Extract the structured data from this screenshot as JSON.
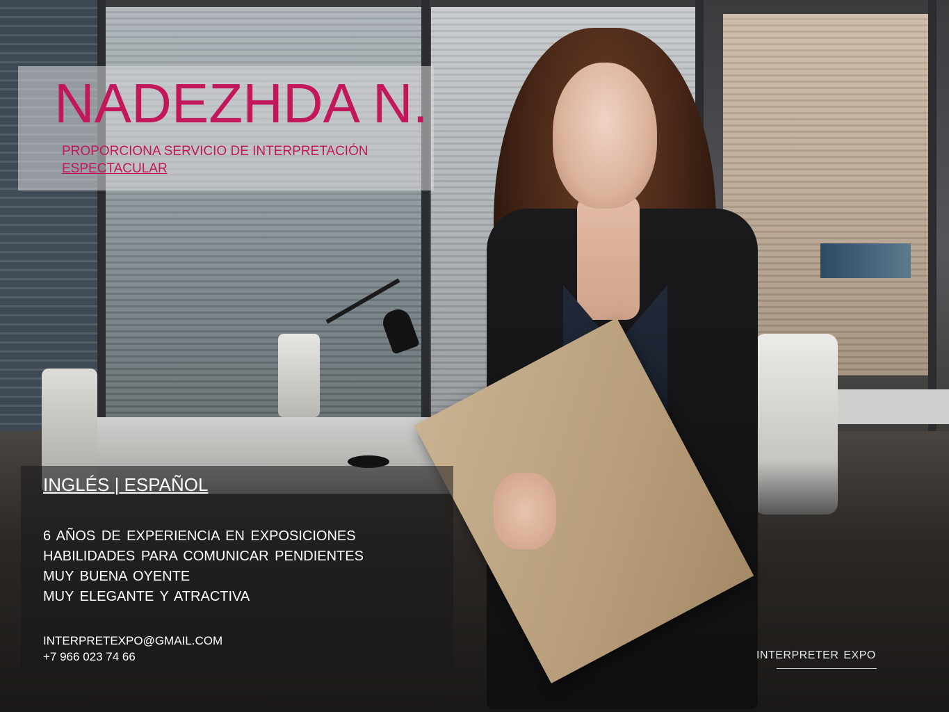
{
  "header": {
    "name": "NADEZHDA N.",
    "tagline_line1": "PROPORCIONA SERVICIO DE INTERPRETACIÓN",
    "tagline_line2": "ESPECTACULAR"
  },
  "profile": {
    "languages": "INGLÉS | ESPAÑOL",
    "skills": [
      "6 AÑOS DE EXPERIENCIA EN EXPOSICIONES",
      "HABILIDADES PARA COMUNICAR PENDIENTES",
      "MUY BUENA OYENTE",
      "MUY ELEGANTE Y ATRACTIVA"
    ]
  },
  "contact": {
    "email": "INTERPRETEXPO@GMAIL.COM",
    "phone": "+7 966 023 74 66"
  },
  "brand": {
    "name": "INTERPRETER EXPO"
  },
  "colors": {
    "accent": "#c2185b",
    "text_light": "#ffffff"
  }
}
